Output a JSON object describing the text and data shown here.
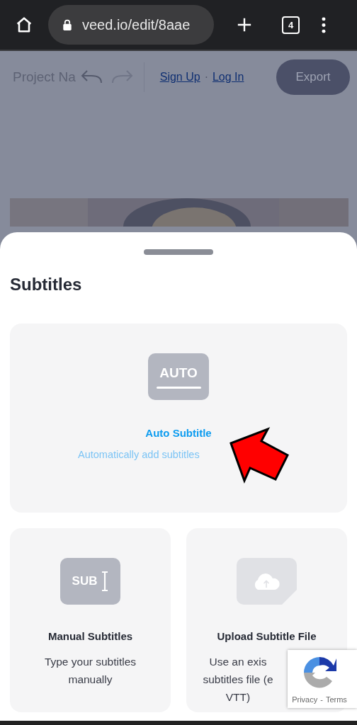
{
  "browser": {
    "url": "veed.io/edit/8aae",
    "tab_count": "4"
  },
  "editor": {
    "project_name": "Project Na",
    "sign_up": "Sign Up",
    "separator": "·",
    "log_in": "Log In",
    "export": "Export"
  },
  "sheet": {
    "title": "Subtitles",
    "options": [
      {
        "kind": "auto",
        "icon_text": "AUTO",
        "title": "Auto Subtitle",
        "description": [
          "Automatically add subtitles"
        ],
        "selected": true
      },
      {
        "kind": "manual",
        "icon_text": "SUB",
        "title": "Manual Subtitles",
        "description": [
          "Type your subtitles",
          "manually"
        ],
        "selected": false
      },
      {
        "kind": "upload",
        "title": "Upload Subtitle File",
        "description": [
          "Use an exis",
          "subtitles file (e",
          "VTT)"
        ],
        "selected": false
      }
    ]
  },
  "recaptcha": {
    "privacy": "Privacy",
    "separator": "-",
    "terms": "Terms"
  },
  "annotation": {
    "kind": "arrow"
  }
}
